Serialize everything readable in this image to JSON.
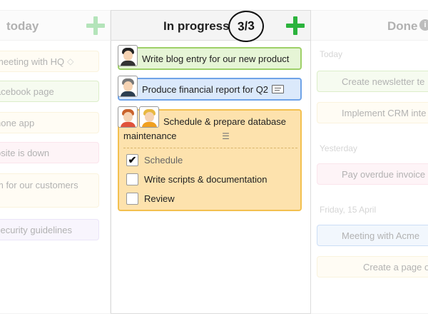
{
  "columns": {
    "today": {
      "title": "today",
      "cards": [
        "meeting with HQ",
        "acebook page",
        "hone app",
        "psite is down",
        "m for our customers",
        "security guidelines"
      ]
    },
    "in_progress": {
      "title": "In progress",
      "count": "3/3",
      "cards": [
        {
          "text": "Write blog entry for our new product",
          "color": "#9ed068"
        },
        {
          "text": "Produce financial report for Q2",
          "color": "#6fa3e8"
        },
        {
          "text": "Schedule & prepare database maintenance",
          "color": "#f3c04f",
          "subtasks": [
            {
              "label": "Schedule",
              "done": true
            },
            {
              "label": "Write scripts & documentation",
              "done": false
            },
            {
              "label": "Review",
              "done": false
            }
          ]
        }
      ]
    },
    "done": {
      "title": "Done",
      "sections": [
        {
          "label": "Today",
          "cards": [
            "Create newsletter te",
            "Implement CRM inte"
          ]
        },
        {
          "label": "Yesterday",
          "cards": [
            "Pay overdue invoice"
          ]
        },
        {
          "label": "Friday, 15 April",
          "cards": [
            "Meeting with Acme",
            "Create a page o"
          ]
        }
      ]
    }
  },
  "accent_green": "#2bb33c"
}
